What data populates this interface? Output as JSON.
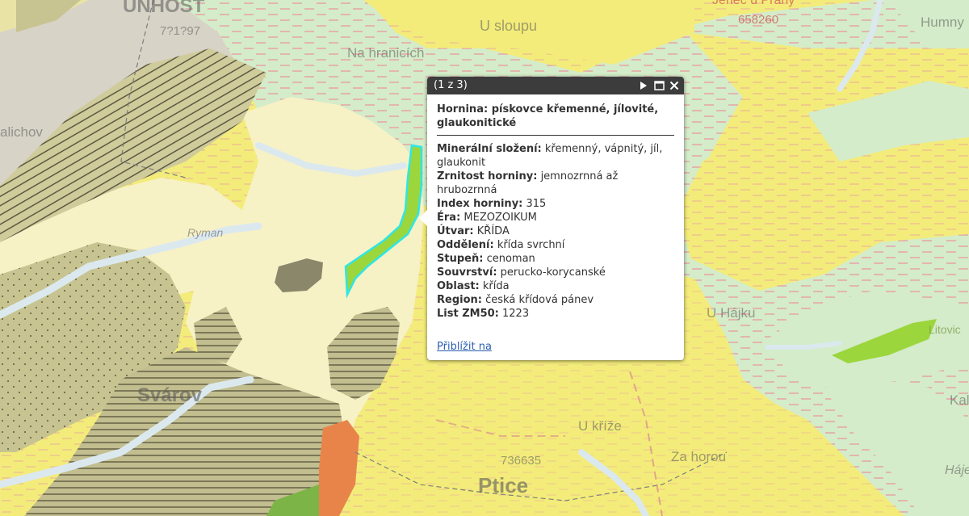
{
  "popup": {
    "counter": "(1 z 3)",
    "header_label": "Hornina:",
    "header_value": "pískovce křemenné, jílovité, glaukonitické",
    "attributes": [
      {
        "label": "Minerální složení:",
        "value": "křemenný, vápnitý, jíl, glaukonit"
      },
      {
        "label": "Zrnitost horniny:",
        "value": "jemnozrnná až hrubozrnná"
      },
      {
        "label": "Index horniny:",
        "value": "315"
      },
      {
        "label": "Éra:",
        "value": "MEZOZOIKUM"
      },
      {
        "label": "Útvar:",
        "value": "KŘÍDA"
      },
      {
        "label": "Oddělení:",
        "value": "křída svrchní"
      },
      {
        "label": "Stupeň:",
        "value": "cenoman"
      },
      {
        "label": "Souvrství:",
        "value": "perucko-korycanské"
      },
      {
        "label": "Oblast:",
        "value": "křída"
      },
      {
        "label": "Region:",
        "value": "česká křídová pánev"
      },
      {
        "label": "List ZM50:",
        "value": "1223"
      }
    ],
    "zoom_link": "Přiblížit na"
  },
  "map_labels": {
    "unhost": "UNHOŠŤ",
    "unhost_num": "7?1?97",
    "na_hranicich": "Na hranicích",
    "u_sloupu": "U sloupu",
    "jenec": "Jeneč u Prahy",
    "jenec_num": "658260",
    "humny": "Humny",
    "malichov": "alichov",
    "ryman": "Ryman",
    "svarov": "Svárov",
    "u_hajku": "U Hájku",
    "litovice": "Litovic",
    "u_krize": "U kříže",
    "za_horou": "Za horou",
    "num_736635": "736635",
    "ptice": "Ptice",
    "kal": "Kal",
    "haje": "Háje"
  },
  "colors": {
    "yellow": "#f3ec7a",
    "cream": "#f7f1c6",
    "green_dashed": "#d4ecc9",
    "olive": "#c7c491",
    "hatch": "#a8a47e",
    "orange": "#e8844a",
    "highlight": "#2ee6e6",
    "water": "#dbe9ef"
  }
}
